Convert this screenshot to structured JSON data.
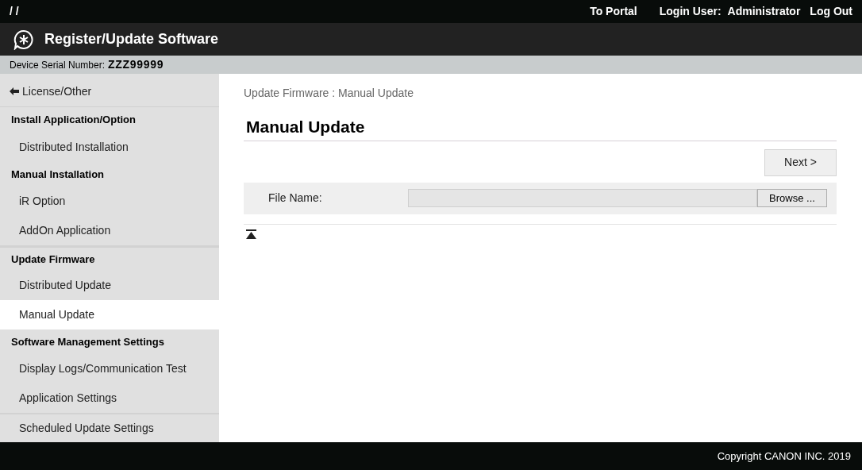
{
  "top_bar": {
    "breadcrumb": "/ /",
    "links": [
      "To Portal"
    ],
    "login_label": "Login User:",
    "user": "Administrator",
    "logout": "Log Out"
  },
  "header": {
    "title": "Register/Update Software"
  },
  "serial": {
    "label": "Device Serial Number:",
    "value": "ZZZ99999"
  },
  "sidebar": {
    "items": [
      {
        "kind": "back",
        "label": "License/Other",
        "selected": false
      },
      {
        "kind": "heading",
        "label": "Install Application/Option"
      },
      {
        "kind": "item",
        "label": "Distributed Installation",
        "selected": false
      },
      {
        "kind": "heading",
        "label": "Manual Installation"
      },
      {
        "kind": "item",
        "label": "iR Option",
        "selected": false
      },
      {
        "kind": "item",
        "label": "AddOn Application",
        "selected": false
      },
      {
        "kind": "heading",
        "label": "Update Firmware"
      },
      {
        "kind": "item",
        "label": "Distributed Update",
        "selected": false
      },
      {
        "kind": "item",
        "label": "Manual Update",
        "selected": true
      },
      {
        "kind": "heading",
        "label": "Software Management Settings"
      },
      {
        "kind": "item",
        "label": "Display Logs/Communication Test",
        "selected": false
      },
      {
        "kind": "item",
        "label": "Application Settings",
        "selected": false
      },
      {
        "kind": "item",
        "label": "Scheduled Update Settings",
        "selected": false
      }
    ]
  },
  "main": {
    "breadcrumb": "Update Firmware : Manual Update",
    "title": "Manual Update",
    "next_button": "Next >",
    "file_label": "File Name:",
    "browse_button": "Browse ..."
  },
  "footer": {
    "copyright": "Copyright CANON INC. 2019"
  }
}
